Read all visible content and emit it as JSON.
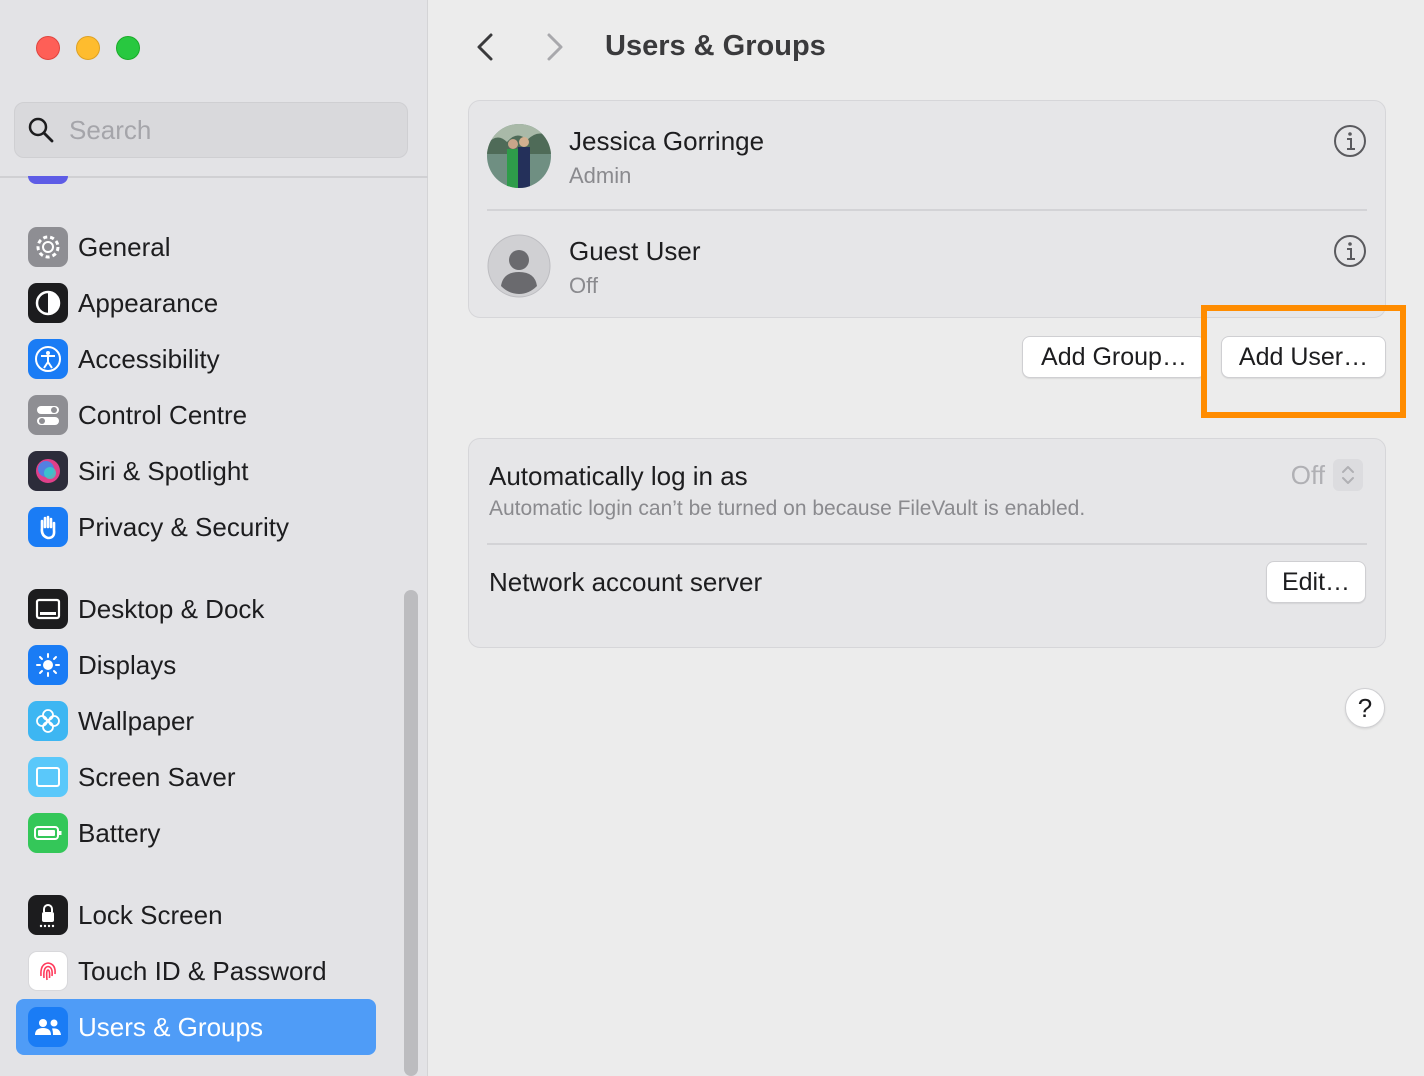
{
  "sidebar": {
    "search_placeholder": "Search",
    "items": [
      {
        "label": "General",
        "icon": "gear-icon",
        "color": "#8e8e93"
      },
      {
        "label": "Appearance",
        "icon": "appearance-icon",
        "color": "#1c1c1e"
      },
      {
        "label": "Accessibility",
        "icon": "accessibility-icon",
        "color": "#1a7cf5"
      },
      {
        "label": "Control Centre",
        "icon": "control-centre-icon",
        "color": "#8e8e93"
      },
      {
        "label": "Siri & Spotlight",
        "icon": "siri-icon",
        "color": "#2c2c3a"
      },
      {
        "label": "Privacy & Security",
        "icon": "hand-icon",
        "color": "#1a7cf5"
      },
      {
        "label": "Desktop & Dock",
        "icon": "dock-icon",
        "color": "#1c1c1e"
      },
      {
        "label": "Displays",
        "icon": "sun-icon",
        "color": "#1a7cf5"
      },
      {
        "label": "Wallpaper",
        "icon": "flower-icon",
        "color": "#3db6f2"
      },
      {
        "label": "Screen Saver",
        "icon": "screen-saver-icon",
        "color": "#5ac8fa"
      },
      {
        "label": "Battery",
        "icon": "battery-icon",
        "color": "#34c759"
      },
      {
        "label": "Lock Screen",
        "icon": "lock-icon",
        "color": "#1c1c1e"
      },
      {
        "label": "Touch ID & Password",
        "icon": "fingerprint-icon",
        "color": "#ffffff"
      },
      {
        "label": "Users & Groups",
        "icon": "users-icon",
        "color": "#1a7cf5",
        "active": true
      }
    ]
  },
  "header": {
    "title": "Users & Groups"
  },
  "users": [
    {
      "name": "Jessica Gorringe",
      "role": "Admin"
    },
    {
      "name": "Guest User",
      "role": "Off"
    }
  ],
  "buttons": {
    "add_group": "Add Group…",
    "add_user": "Add User…",
    "edit": "Edit…"
  },
  "login": {
    "title": "Automatically log in as",
    "subtitle": "Automatic login can’t be turned on because FileVault is enabled.",
    "value": "Off",
    "network_label": "Network account server"
  },
  "help": "?",
  "colors": {
    "highlight": "#ff8c00",
    "active_item": "#4f9cf7"
  }
}
